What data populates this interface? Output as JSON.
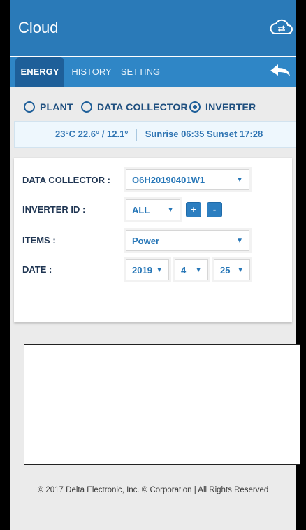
{
  "app": {
    "title": "Cloud",
    "sync_icon": "cloud-sync-icon"
  },
  "tabs": [
    {
      "label": "ENERGY",
      "active": true
    },
    {
      "label": "HISTORY",
      "active": false
    },
    {
      "label": "SETTING",
      "active": false
    }
  ],
  "back_icon": "reply-arrow-icon",
  "view_options": [
    {
      "label": "PLANT",
      "checked": false
    },
    {
      "label": "DATA COLLECTOR",
      "checked": false
    },
    {
      "label": "INVERTER",
      "checked": true
    }
  ],
  "weather": {
    "temp": "23°C",
    "range": "22.6° / 12.1°",
    "sunrise_label": "Sunrise",
    "sunrise": "06:35",
    "sunset_label": "Sunset",
    "sunset": "17:28"
  },
  "form": {
    "data_collector": {
      "label": "DATA COLLECTOR :",
      "value": "O6H20190401W1"
    },
    "inverter_id": {
      "label": "INVERTER ID :",
      "value": "ALL",
      "add_label": "+",
      "remove_label": "-"
    },
    "items": {
      "label": "ITEMS :",
      "value": "Power"
    },
    "date": {
      "label": "DATE :",
      "year": "2019",
      "month": "4",
      "day": "25"
    }
  },
  "footer": {
    "text": "© 2017 Delta Electronic, Inc. © Corporation | All Rights Reserved"
  },
  "colors": {
    "appbar": "#2a7ab8",
    "tabbar": "#2f86c6",
    "active_tab": "#1e5f99",
    "accent_text": "#2676b7"
  }
}
